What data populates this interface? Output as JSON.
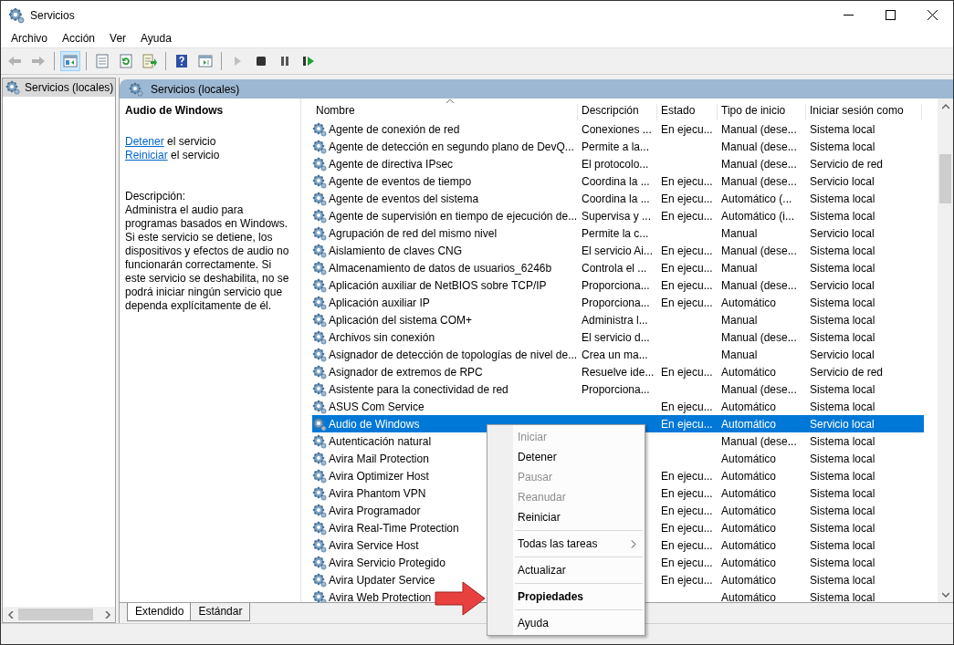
{
  "window": {
    "title": "Servicios"
  },
  "menu": [
    "Archivo",
    "Acción",
    "Ver",
    "Ayuda"
  ],
  "toolbar": [
    {
      "kind": "back",
      "disabled": true,
      "pressed": false
    },
    {
      "kind": "forward",
      "disabled": true,
      "pressed": false
    },
    {
      "kind": "tree",
      "disabled": false,
      "pressed": true
    },
    {
      "kind": "properties",
      "disabled": false,
      "pressed": false
    },
    {
      "kind": "refresh",
      "disabled": false,
      "pressed": false
    },
    {
      "kind": "export",
      "disabled": false,
      "pressed": false
    },
    {
      "kind": "help",
      "disabled": false,
      "pressed": false
    },
    {
      "kind": "console",
      "disabled": false,
      "pressed": false
    },
    {
      "kind": "play",
      "disabled": true,
      "pressed": false
    },
    {
      "kind": "stop",
      "disabled": false,
      "pressed": false
    },
    {
      "kind": "pause",
      "disabled": false,
      "pressed": false
    },
    {
      "kind": "resume",
      "disabled": false,
      "pressed": false
    }
  ],
  "tree": {
    "items": [
      {
        "label": "Servicios (locales)",
        "selected": true
      }
    ]
  },
  "panel_header": "Servicios (locales)",
  "details": {
    "title": "Audio de Windows",
    "actions": [
      {
        "link": "Detener",
        "text": "el servicio"
      },
      {
        "link": "Reiniciar",
        "text": "el servicio"
      }
    ],
    "description_label": "Descripción:",
    "description": "Administra el audio para programas basados en Windows. Si este servicio se detiene, los dispositivos y efectos de audio no funcionarán correctamente. Si este servicio se deshabilita, no se podrá iniciar ningún servicio que dependa explícitamente de él."
  },
  "table": {
    "columns": [
      "Nombre",
      "Descripción",
      "Estado",
      "Tipo de inicio",
      "Iniciar sesión como"
    ],
    "rows": [
      {
        "name": "Agente de conexión de red",
        "description": "Conexiones ...",
        "status": "En ejecu...",
        "startup": "Manual (dese...",
        "logon": "Sistema local",
        "selected": false
      },
      {
        "name": "Agente de detección en segundo plano de DevQ...",
        "description": "Permite a la...",
        "startup": "Manual (dese...",
        "logon": "Sistema local",
        "selected": false
      },
      {
        "name": "Agente de directiva IPsec",
        "description": "El protocolo...",
        "startup": "Manual (dese...",
        "logon": "Servicio de red",
        "selected": false
      },
      {
        "name": "Agente de eventos de tiempo",
        "description": "Coordina la ...",
        "status": "En ejecu...",
        "startup": "Manual (dese...",
        "logon": "Servicio local",
        "selected": false
      },
      {
        "name": "Agente de eventos del sistema",
        "description": "Coordina la ...",
        "status": "En ejecu...",
        "startup": "Automático (...",
        "logon": "Sistema local",
        "selected": false
      },
      {
        "name": "Agente de supervisión en tiempo de ejecución de...",
        "description": "Supervisa y ...",
        "status": "En ejecu...",
        "startup": "Automático (i...",
        "logon": "Sistema local",
        "selected": false
      },
      {
        "name": "Agrupación de red del mismo nivel",
        "description": "Permite la c...",
        "startup": "Manual",
        "logon": "Servicio local",
        "selected": false
      },
      {
        "name": "Aislamiento de claves CNG",
        "description": "El servicio Ai...",
        "status": "En ejecu...",
        "startup": "Manual (dese...",
        "logon": "Sistema local",
        "selected": false
      },
      {
        "name": "Almacenamiento de datos de usuarios_6246b",
        "description": "Controla el ...",
        "status": "En ejecu...",
        "startup": "Manual",
        "logon": "Sistema local",
        "selected": false
      },
      {
        "name": "Aplicación auxiliar de NetBIOS sobre TCP/IP",
        "description": "Proporciona...",
        "status": "En ejecu...",
        "startup": "Manual (dese...",
        "logon": "Servicio local",
        "selected": false
      },
      {
        "name": "Aplicación auxiliar IP",
        "description": "Proporciona...",
        "status": "En ejecu...",
        "startup": "Automático",
        "logon": "Sistema local",
        "selected": false
      },
      {
        "name": "Aplicación del sistema COM+",
        "description": "Administra l...",
        "startup": "Manual",
        "logon": "Sistema local",
        "selected": false
      },
      {
        "name": "Archivos sin conexión",
        "description": "El servicio d...",
        "startup": "Manual (dese...",
        "logon": "Sistema local",
        "selected": false
      },
      {
        "name": "Asignador de detección de topologías de nivel de...",
        "description": "Crea un ma...",
        "startup": "Manual",
        "logon": "Servicio local",
        "selected": false
      },
      {
        "name": "Asignador de extremos de RPC",
        "description": "Resuelve ide...",
        "status": "En ejecu...",
        "startup": "Automático",
        "logon": "Servicio de red",
        "selected": false
      },
      {
        "name": "Asistente para la conectividad de red",
        "description": "Proporciona...",
        "startup": "Manual (dese...",
        "logon": "Sistema local",
        "selected": false
      },
      {
        "name": "ASUS Com Service",
        "status": "En ejecu...",
        "startup": "Automático",
        "logon": "Sistema local",
        "selected": false
      },
      {
        "name": "Audio de Windows",
        "status": "En ejecu...",
        "startup": "Automático",
        "logon": "Servicio local",
        "selected": true
      },
      {
        "name": "Autenticación natural",
        "startup": "Manual (dese...",
        "logon": "Sistema local",
        "selected": false
      },
      {
        "name": "Avira Mail Protection",
        "startup": "Automático",
        "logon": "Sistema local",
        "selected": false
      },
      {
        "name": "Avira Optimizer Host",
        "status": "En ejecu...",
        "startup": "Automático",
        "logon": "Sistema local",
        "selected": false
      },
      {
        "name": "Avira Phantom VPN",
        "status": "En ejecu...",
        "startup": "Automático",
        "logon": "Sistema local",
        "selected": false
      },
      {
        "name": "Avira Programador",
        "status": "En ejecu...",
        "startup": "Automático",
        "logon": "Sistema local",
        "selected": false
      },
      {
        "name": "Avira Real-Time Protection",
        "status": "En ejecu...",
        "startup": "Automático",
        "logon": "Sistema local",
        "selected": false
      },
      {
        "name": "Avira Service Host",
        "status": "En ejecu...",
        "startup": "Automático",
        "logon": "Sistema local",
        "selected": false
      },
      {
        "name": "Avira Servicio Protegido",
        "status": "En ejecu...",
        "startup": "Automático",
        "logon": "Sistema local",
        "selected": false
      },
      {
        "name": "Avira Updater Service",
        "status": "En ejecu...",
        "startup": "Automático",
        "logon": "Sistema local",
        "selected": false
      },
      {
        "name": "Avira Web Protection",
        "startup": "Automático",
        "logon": "Sistema local",
        "selected": false
      }
    ]
  },
  "context_menu": [
    {
      "label": "Iniciar",
      "disabled": true,
      "bold": false,
      "submenu": false,
      "separator_before": false
    },
    {
      "label": "Detener",
      "disabled": false,
      "bold": false,
      "submenu": false,
      "separator_before": false
    },
    {
      "label": "Pausar",
      "disabled": true,
      "bold": false,
      "submenu": false,
      "separator_before": false
    },
    {
      "label": "Reanudar",
      "disabled": true,
      "bold": false,
      "submenu": false,
      "separator_before": false
    },
    {
      "label": "Reiniciar",
      "disabled": false,
      "bold": false,
      "submenu": false,
      "separator_before": false
    },
    {
      "label": "Todas las tareas",
      "disabled": false,
      "bold": false,
      "submenu": true,
      "separator_before": true
    },
    {
      "label": "Actualizar",
      "disabled": false,
      "bold": false,
      "submenu": false,
      "separator_before": true
    },
    {
      "label": "Propiedades",
      "disabled": false,
      "bold": true,
      "submenu": false,
      "separator_before": true
    },
    {
      "label": "Ayuda",
      "disabled": false,
      "bold": false,
      "submenu": false,
      "separator_before": true
    }
  ],
  "tabs": [
    {
      "label": "Extendido",
      "selected": true
    },
    {
      "label": "Estándar",
      "selected": false
    }
  ]
}
